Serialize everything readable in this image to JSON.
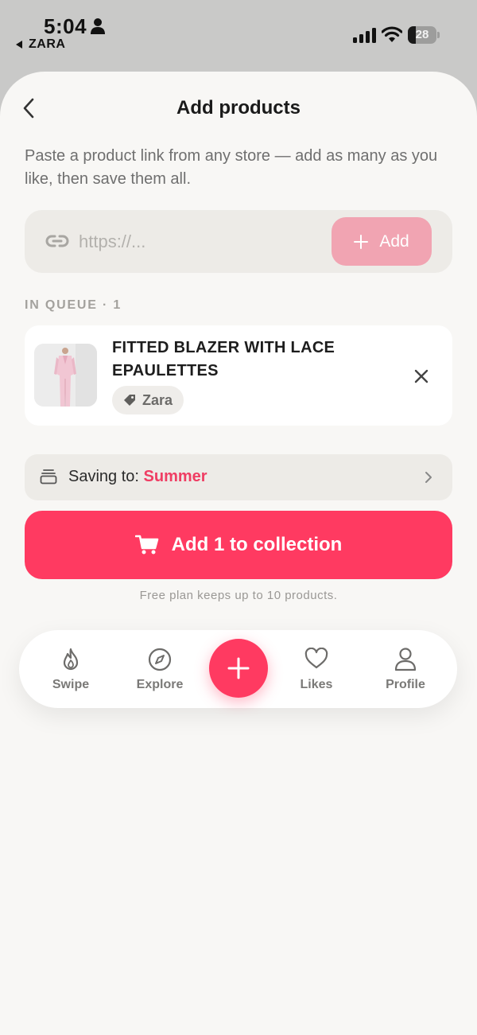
{
  "status_bar": {
    "time": "5:04",
    "back_app": "ZARA",
    "battery_level": 28,
    "battery_text": "28"
  },
  "header": {
    "title": "Add products"
  },
  "instructions": "Paste a product link from any store — add as many as you like, then save them all.",
  "url_input": {
    "placeholder": "https://...",
    "value": "",
    "add_label": "Add"
  },
  "queue": {
    "heading": "IN QUEUE · 1",
    "items": [
      {
        "title": "FITTED BLAZER WITH LACE EPAULETTES",
        "store": "Zara"
      }
    ]
  },
  "collection": {
    "prefix": "Saving to:",
    "name": "Summer"
  },
  "primary_action": {
    "label": "Add 1 to collection"
  },
  "plan_note": "Free plan keeps up to 10 products.",
  "tab_bar": {
    "tabs": [
      {
        "label": "Swipe",
        "icon": "flame-icon"
      },
      {
        "label": "Explore",
        "icon": "compass-icon"
      },
      {
        "label": "Likes",
        "icon": "heart-icon"
      },
      {
        "label": "Profile",
        "icon": "person-icon"
      }
    ],
    "fab_icon": "plus-icon"
  },
  "colors": {
    "accent": "#ff3a61",
    "accent_disabled": "#f1a4b2",
    "sheet_background": "#f8f7f5",
    "field_background": "#edebe7"
  }
}
